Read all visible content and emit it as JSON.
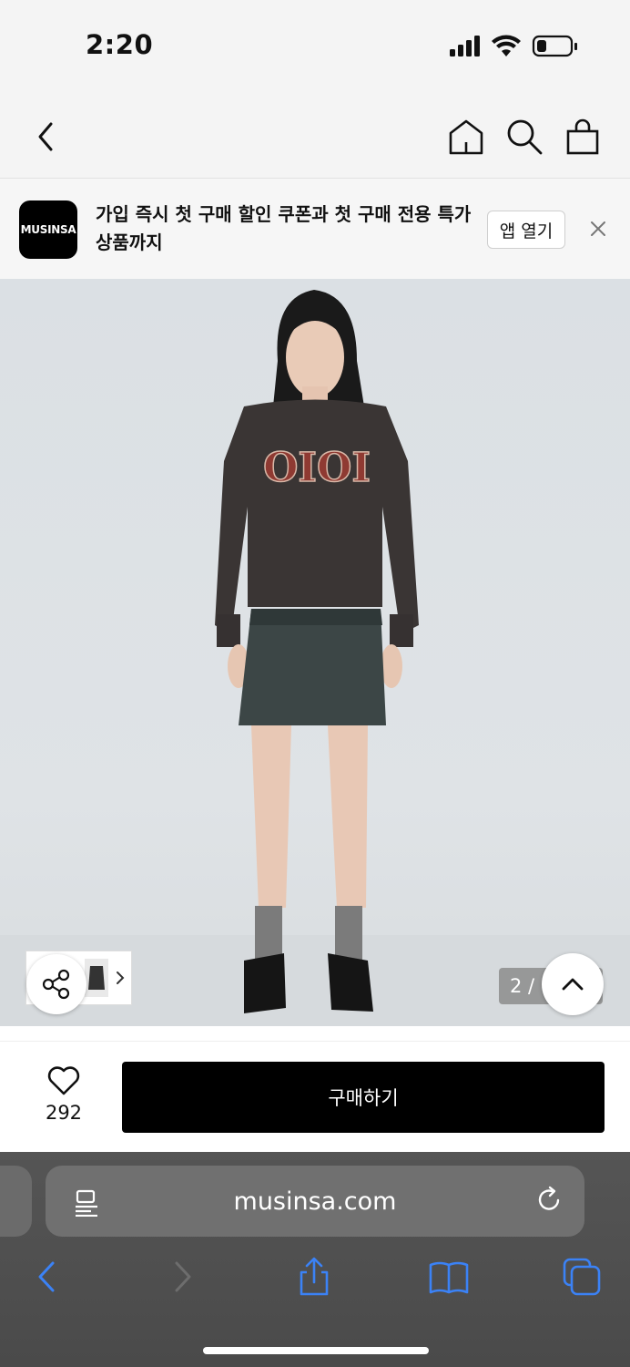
{
  "status_bar": {
    "time": "2:20"
  },
  "nav": {
    "back": "back",
    "home": "home",
    "search": "search",
    "cart": "cart"
  },
  "banner": {
    "logo_text": "MUSINSA",
    "message": "가입 즉시 첫 구매 할인 쿠폰과 첫 구매 전용 특가 상품까지",
    "open_label": "앱 열기"
  },
  "product_image": {
    "page_indicator": "2 /",
    "graphic_text": "OIOI"
  },
  "purchase_bar": {
    "like_count": "292",
    "buy_label": "구매하기"
  },
  "browser": {
    "url": "musinsa.com"
  },
  "colors": {
    "accent": "#000000",
    "safari_blue": "#3b82f6"
  }
}
